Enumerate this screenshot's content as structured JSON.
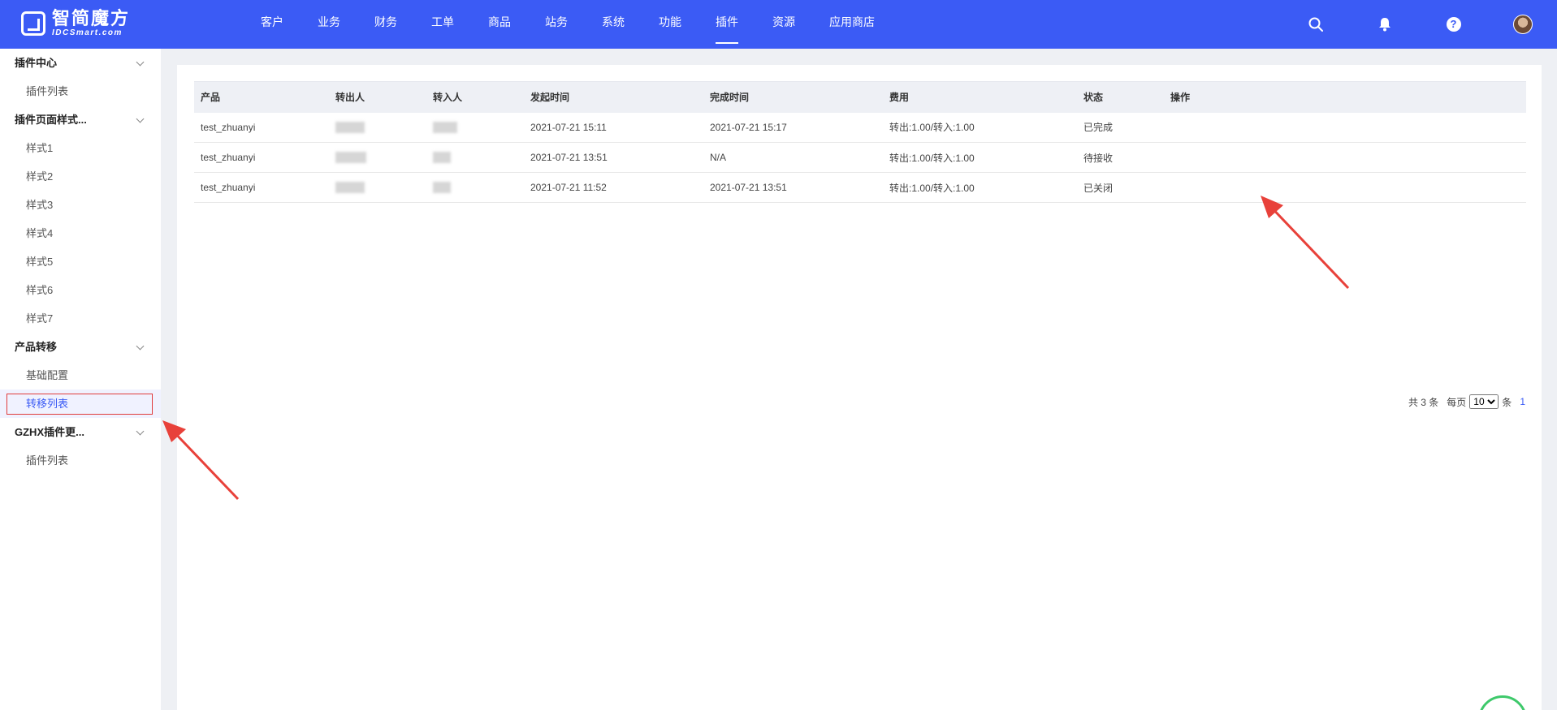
{
  "brand": {
    "name_cn": "智简魔方",
    "name_en": "IDCSmart.com"
  },
  "nav": {
    "items": [
      "客户",
      "业务",
      "财务",
      "工单",
      "商品",
      "站务",
      "系统",
      "功能",
      "插件",
      "资源",
      "应用商店"
    ],
    "active": "插件"
  },
  "header_icons": [
    "search-icon",
    "bell-icon",
    "help-icon",
    "avatar"
  ],
  "help_glyph": "?",
  "sidebar": {
    "groups": [
      {
        "title": "插件中心",
        "items": [
          "插件列表"
        ]
      },
      {
        "title": "插件页面样式...",
        "items": [
          "样式1",
          "样式2",
          "样式3",
          "样式4",
          "样式5",
          "样式6",
          "样式7"
        ]
      },
      {
        "title": "产品转移",
        "items": [
          "基础配置",
          "转移列表"
        ]
      },
      {
        "title": "GZHX插件更...",
        "items": [
          "插件列表"
        ]
      }
    ],
    "active_item": "转移列表"
  },
  "table": {
    "headers": [
      "产品",
      "转出人",
      "转入人",
      "发起时间",
      "完成时间",
      "费用",
      "状态",
      "操作"
    ],
    "rows": [
      {
        "product": "test_zhuanyi",
        "start": "2021-07-21 15:11",
        "finish": "2021-07-21 15:17",
        "fee": "转出:1.00/转入:1.00",
        "status": "已完成"
      },
      {
        "product": "test_zhuanyi",
        "start": "2021-07-21 13:51",
        "finish": "N/A",
        "fee": "转出:1.00/转入:1.00",
        "status": "待接收"
      },
      {
        "product": "test_zhuanyi",
        "start": "2021-07-21 11:52",
        "finish": "2021-07-21 13:51",
        "fee": "转出:1.00/转入:1.00",
        "status": "已关闭"
      }
    ]
  },
  "pagination": {
    "total_text": "共 3 条",
    "per_page_label": "每页",
    "per_page_value": "10",
    "unit": "条",
    "current_page": "1"
  },
  "colors": {
    "primary": "#3b5bf5",
    "highlight": "#e03c3c",
    "annotation_arrow": "#e8413a"
  }
}
